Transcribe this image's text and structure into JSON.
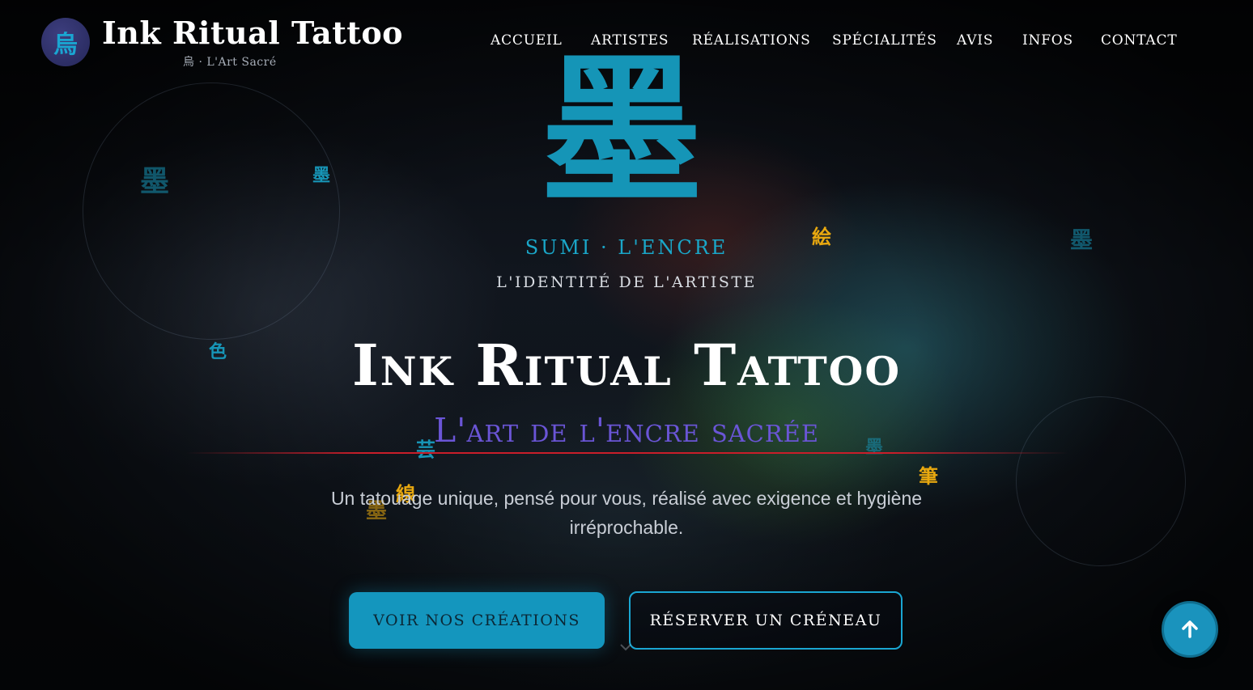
{
  "header": {
    "logo_glyph": "烏",
    "brand_title": "Ink Ritual Tattoo",
    "brand_subtitle": "烏 · L'Art Sacré"
  },
  "nav": {
    "items": [
      {
        "label": "ACCUEIL"
      },
      {
        "label": "ARTISTES"
      },
      {
        "label": "RÉALISATIONS"
      },
      {
        "label": "SPÉCIALITÉS"
      },
      {
        "label": "AVIS"
      },
      {
        "label": "INFOS"
      },
      {
        "label": "CONTACT"
      }
    ]
  },
  "emblem": {
    "kanji": "墨",
    "caption": "SUMI · L'ENCRE",
    "subcaption": "L'IDENTITÉ DE L'ARTISTE"
  },
  "floating_glyphs": [
    "墨",
    "墨",
    "色",
    "絵",
    "墨",
    "芸",
    "線",
    "墨",
    "墨",
    "筆"
  ],
  "hero": {
    "title": "Ink Ritual Tattoo",
    "tagline": "L'art de l'encre sacrée",
    "description": "Un tatouage unique, pensé pour vous, réalisé avec exigence et hygiène irréprochable."
  },
  "cta": {
    "primary_label": "VOIR NOS CRÉATIONS",
    "secondary_label": "RÉSERVER UN CRÉNEAU"
  },
  "icons": {
    "back_to_top": "arrow-up-icon",
    "scroll_hint": "chevron-down-icon"
  },
  "colors": {
    "accent_teal": "#1496be",
    "accent_purple": "#6a55d6",
    "accent_gold": "#e8a80f",
    "accent_red": "#c91e2a",
    "background": "#0b0f16"
  }
}
